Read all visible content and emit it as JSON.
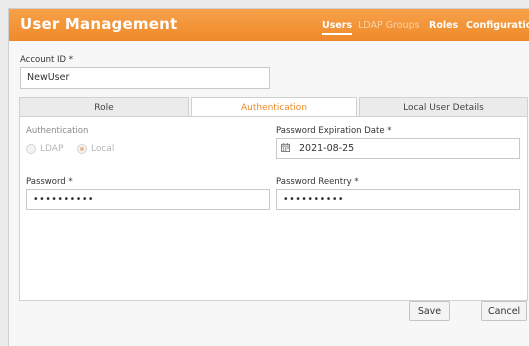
{
  "header": {
    "title": "User Management",
    "nav": [
      "Users",
      "LDAP Groups",
      "Roles",
      "Configuration"
    ],
    "active_nav": "Users"
  },
  "form": {
    "account_id_label": "Account ID *",
    "account_id_value": "NewUser",
    "tabs": [
      "Role",
      "Authentication",
      "Local User Details"
    ],
    "active_tab": "Authentication",
    "authentication_label": "Authentication",
    "auth_options": [
      "LDAP",
      "Local"
    ],
    "auth_selected": "Local",
    "password_expiration_label": "Password Expiration Date *",
    "password_expiration_value": "2021-08-25",
    "password_label": "Password *",
    "password_value": "••••••••••",
    "password_reentry_label": "Password Reentry *",
    "password_reentry_value": "••••••••••"
  },
  "actions": {
    "save_label": "Save",
    "cancel_label": "Cancel"
  },
  "colors": {
    "header_accent": "#ef8a2a",
    "active_tab_text": "#ef8a2a"
  },
  "icons": {
    "date": "calendar-icon"
  }
}
